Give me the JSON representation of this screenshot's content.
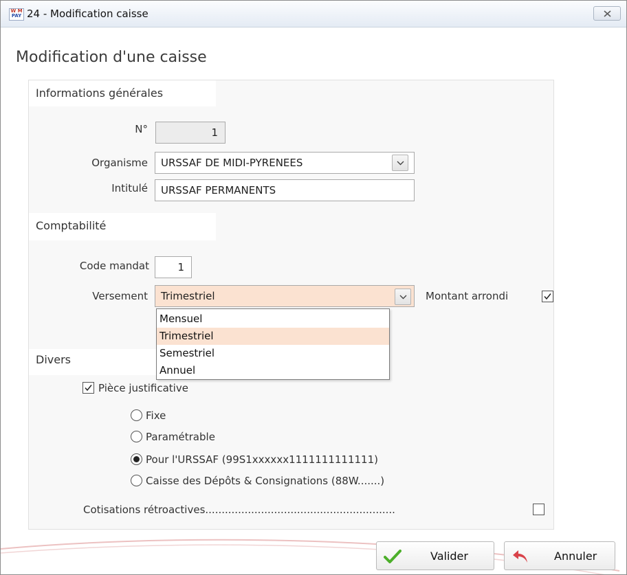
{
  "window": {
    "title": "24 - Modification caisse"
  },
  "page": {
    "title": "Modification d'une caisse"
  },
  "general": {
    "heading": "Informations générales",
    "num_label": "N°",
    "num_value": "1",
    "organisme_label": "Organisme",
    "organisme_value": "URSSAF DE MIDI-PYRENEES",
    "intitule_label": "Intitulé",
    "intitule_value": "URSSAF PERMANENTS"
  },
  "compta": {
    "heading": "Comptabilité",
    "code_label": "Code mandat",
    "code_value": "1",
    "versement_label": "Versement",
    "versement_value": "Trimestriel",
    "arrondi_label": "Montant arrondi",
    "arrondi_checked": true,
    "options": [
      "Mensuel",
      "Trimestriel",
      "Semestriel",
      "Annuel"
    ],
    "selected_option": "Trimestriel"
  },
  "divers": {
    "heading": "Divers",
    "piece_label": "Pièce justificative",
    "piece_checked": true,
    "radios": [
      {
        "label": "Fixe",
        "selected": false
      },
      {
        "label": "Paramétrable",
        "selected": false
      },
      {
        "label": "Pour l'URSSAF (99S1xxxxxx1111111111111)",
        "selected": true
      },
      {
        "label": "Caisse des Dépôts & Consignations (88W.......)",
        "selected": false
      }
    ],
    "cotisations_label": "Cotisations rétroactives..........................................................",
    "cotisations_checked": false
  },
  "buttons": {
    "validate": "Valider",
    "cancel": "Annuler"
  },
  "icons": {
    "app": "app-logo-icon",
    "close": "close-icon",
    "chevron": "chevron-down-icon",
    "check": "check-icon",
    "validate": "green-check-icon",
    "cancel": "undo-arrow-icon"
  },
  "colors": {
    "selection": "#fbe2d1",
    "validate_icon": "#4caf2a",
    "cancel_icon": "#d9434a"
  }
}
